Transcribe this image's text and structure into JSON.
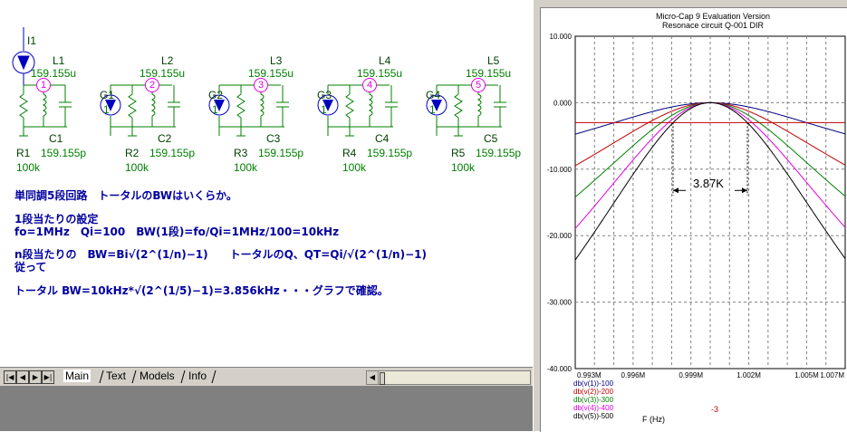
{
  "schematic": {
    "source": {
      "name": "I1"
    },
    "inductors": [
      {
        "name": "L1",
        "value": "159.155u",
        "node": "1"
      },
      {
        "name": "L2",
        "value": "159.155u",
        "node": "2"
      },
      {
        "name": "L3",
        "value": "159.155u",
        "node": "3"
      },
      {
        "name": "L4",
        "value": "159.155u",
        "node": "4"
      },
      {
        "name": "L5",
        "value": "159.155u",
        "node": "5"
      }
    ],
    "capacitors": [
      {
        "name": "C1",
        "value": "159.155p"
      },
      {
        "name": "C2",
        "value": "159.155p"
      },
      {
        "name": "C3",
        "value": "159.155p"
      },
      {
        "name": "C4",
        "value": "159.155p"
      },
      {
        "name": "C5",
        "value": "159.155p"
      }
    ],
    "resistors": [
      {
        "name": "R1",
        "value": "100k"
      },
      {
        "name": "R2",
        "value": "100k"
      },
      {
        "name": "R3",
        "value": "100k"
      },
      {
        "name": "R4",
        "value": "100k"
      },
      {
        "name": "R5",
        "value": "100k"
      }
    ],
    "gm_sources": [
      {
        "name": "G1",
        "value": "1"
      },
      {
        "name": "G2",
        "value": "1"
      },
      {
        "name": "G3",
        "value": "1"
      },
      {
        "name": "G4",
        "value": "1"
      }
    ]
  },
  "notes": [
    "単同調5段回路　トータルのBWはいくらか。",
    "1段当たりの設定",
    "fo=1MHz　Qi=100　BW(1段)=fo/Qi=1MHz/100=10kHz",
    "n段当たりの　BW=Bi√(2^(1/n)−1)　　トータルのQ、QT=Qi/√(2^(1/n)−1)",
    "従って",
    "トータル BW=10kHz*√(2^(1/5)−1)=3.856kHz・・・グラフで確認。"
  ],
  "tabs": [
    {
      "label": "Main",
      "active": true
    },
    {
      "label": "Text",
      "active": false
    },
    {
      "label": "Models",
      "active": false
    },
    {
      "label": "Info",
      "active": false
    }
  ],
  "plot": {
    "title": "Micro-Cap 9 Evaluation Version",
    "subtitle": "Resonace circuit Q-001 DIR",
    "annotation": "3.87K",
    "xlabel": "F (Hz)",
    "cursor_value": "-3",
    "legend": [
      "db(v(1))-100",
      "db(v(2))-200",
      "db(v(3))-300",
      "db(v(4))-400",
      "db(v(5))-500"
    ]
  },
  "chart_data": {
    "type": "line",
    "title": "Micro-Cap 9 Evaluation Version",
    "subtitle": "Resonace circuit Q-001 DIR",
    "xlabel": "F (Hz)",
    "ylabel": "",
    "x_ticks": [
      "0.993M",
      "0.996M",
      "0.999M",
      "1.002M",
      "1.005M",
      "1.007M"
    ],
    "y_ticks": [
      "10.000",
      "0.000",
      "-10.000",
      "-20.000",
      "-30.000",
      "-40.000"
    ],
    "xlim": [
      993000,
      1007000
    ],
    "ylim": [
      -40,
      10
    ],
    "grid": true,
    "f0": 1000000,
    "Q": 100,
    "reference_level": -3,
    "series": [
      {
        "name": "db(v(1))-100",
        "stages": 1,
        "color": "#000080"
      },
      {
        "name": "db(v(2))-200",
        "stages": 2,
        "color": "#c00000"
      },
      {
        "name": "db(v(3))-300",
        "stages": 3,
        "color": "#008000"
      },
      {
        "name": "db(v(4))-400",
        "stages": 4,
        "color": "#e000e0"
      },
      {
        "name": "db(v(5))-500",
        "stages": 5,
        "color": "#000000"
      }
    ]
  }
}
